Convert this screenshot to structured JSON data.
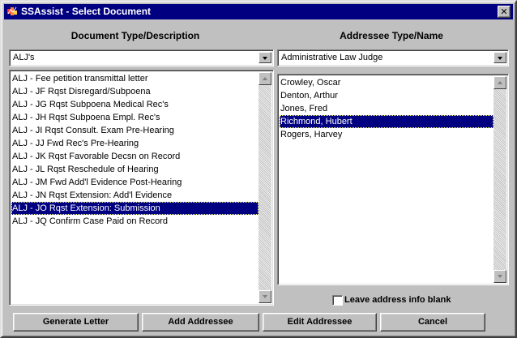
{
  "window": {
    "title": "SSAssist - Select Document",
    "close_glyph": "✕"
  },
  "left": {
    "heading": "Document Type/Description",
    "combo_value": "ALJ's",
    "items": [
      "ALJ - Fee petition transmittal letter",
      "ALJ - JF Rqst Disregard/Subpoena",
      "ALJ - JG Rqst Subpoena Medical Rec's",
      "ALJ - JH Rqst Subpoena Empl. Rec's",
      "ALJ - JI Rqst Consult. Exam Pre-Hearing",
      "ALJ - JJ Fwd Rec's Pre-Hearing",
      "ALJ - JK Rqst Favorable Decsn on Record",
      "ALJ - JL Rqst Reschedule of Hearing",
      "ALJ - JM Fwd Add'l Evidence Post-Hearing",
      "ALJ - JN Rqst Extension: Add'l Evidence",
      "ALJ - JO Rqst Extension: Submission",
      "ALJ - JQ Confirm Case Paid on Record"
    ],
    "selected_index": 10
  },
  "right": {
    "heading": "Addressee Type/Name",
    "combo_value": "Administrative Law Judge",
    "items": [
      "Crowley, Oscar",
      "Denton, Arthur",
      "Jones, Fred",
      "Richmond, Hubert",
      "Rogers, Harvey"
    ],
    "selected_index": 3
  },
  "checkbox": {
    "label": "Leave address info blank",
    "checked": false
  },
  "buttons": {
    "generate": "Generate Letter",
    "add": "Add Addressee",
    "edit": "Edit Addressee",
    "cancel": "Cancel"
  },
  "colors": {
    "face": "#c0c0c0",
    "titlebar": "#000080",
    "selection": "#000080"
  },
  "icons": {
    "app": "ssassist-app-icon",
    "close": "close-icon",
    "dropdown": "chevron-down-icon"
  }
}
